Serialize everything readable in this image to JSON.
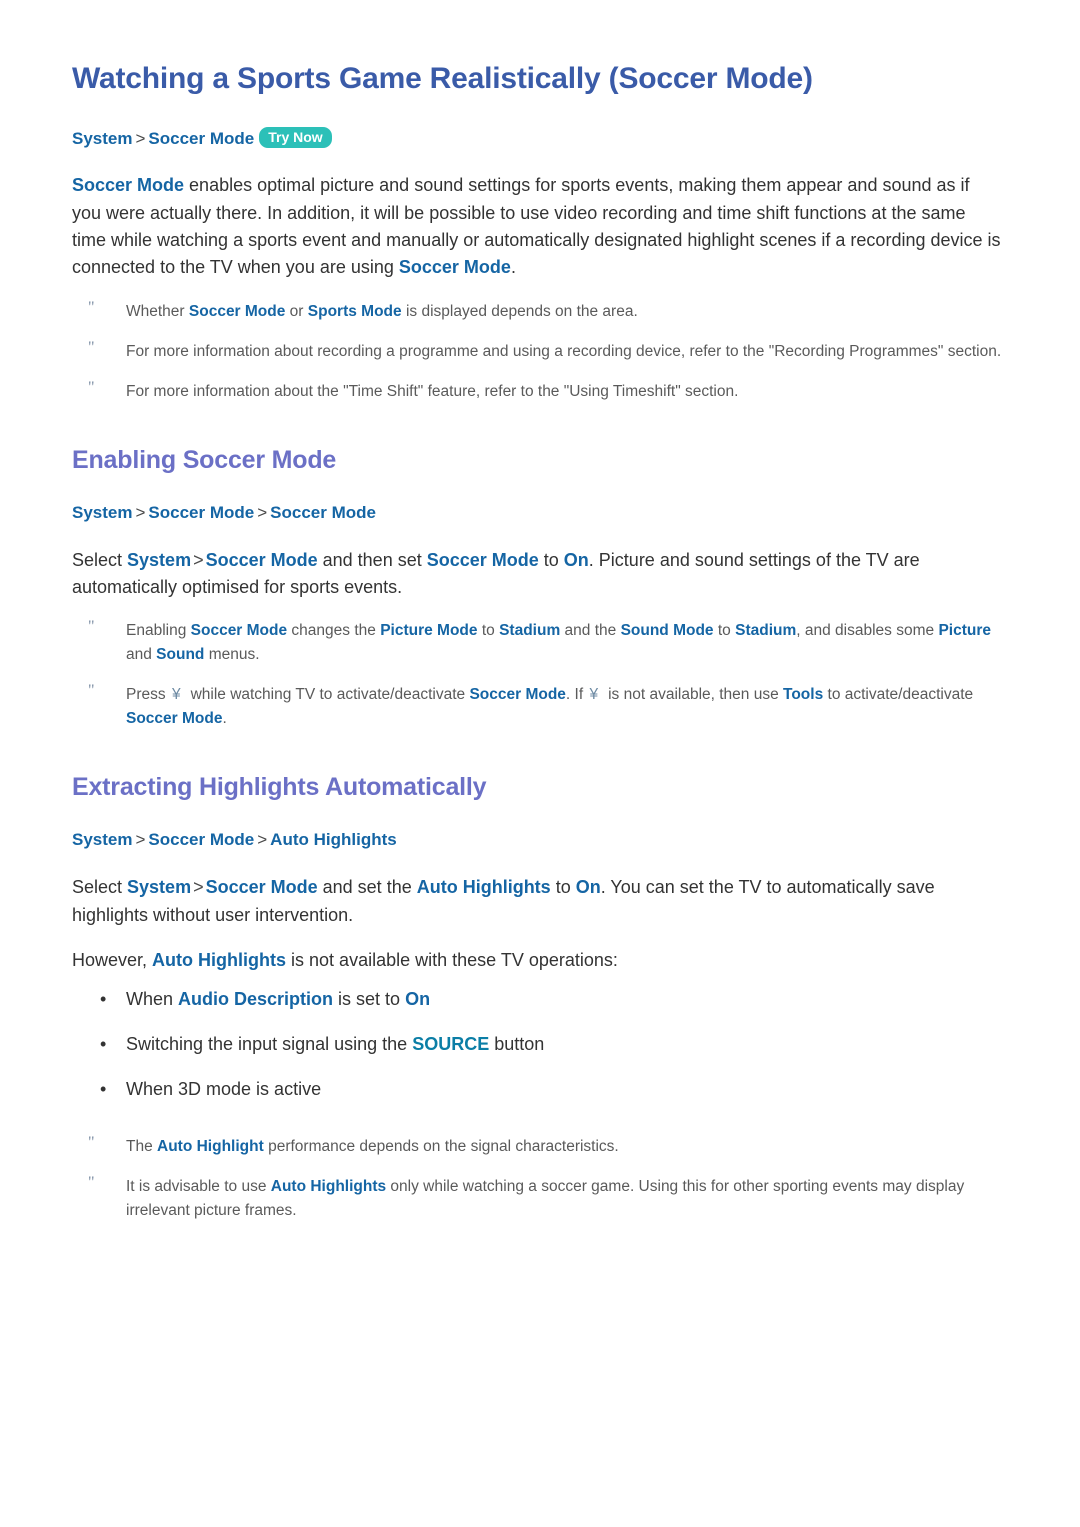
{
  "document": {
    "title": "Watching a Sports Game Realistically (Soccer Mode)"
  },
  "colors": {
    "title": "#3a5ba8",
    "section_heading": "#6b70c6",
    "keyword": "#1565a4",
    "source_keyword": "#0b7ea6",
    "try_now_badge": "#2cc0b8",
    "body_text": "#333333",
    "note_text": "#5a5a5a",
    "note_mark": "#7b8da3"
  },
  "intro": {
    "breadcrumb": {
      "items": [
        "System",
        "Soccer Mode"
      ],
      "separator": ">",
      "badge": "Try Now"
    },
    "paragraph": {
      "kw1": "Soccer Mode",
      "t1": " enables optimal picture and sound settings for sports events, making them appear and sound as if you were actually there. In addition, it will be possible to use video recording and time shift functions at the same time while watching a sports event and manually or automatically designated highlight scenes if a recording device is connected to the TV when you are using ",
      "kw2": "Soccer Mode",
      "t2": "."
    },
    "notes": [
      {
        "mark": "\"",
        "t1": "Whether ",
        "kw1": "Soccer Mode",
        "t2": " or ",
        "kw2": "Sports Mode",
        "t3": " is displayed depends on the area."
      },
      {
        "mark": "\"",
        "t1": "For more information about recording a programme and using a recording device, refer to the \"Recording Programmes\" section."
      },
      {
        "mark": "\"",
        "t1": "For more information about the \"Time Shift\" feature, refer to the \"Using Timeshift\" section."
      }
    ]
  },
  "enabling": {
    "heading": "Enabling Soccer Mode",
    "breadcrumb": {
      "items": [
        "System",
        "Soccer Mode",
        "Soccer Mode"
      ],
      "separator": ">"
    },
    "paragraph": {
      "t0": "Select ",
      "kw1": "System",
      "sep": ">",
      "kw2": "Soccer Mode",
      "t1": " and then set ",
      "kw3": "Soccer Mode",
      "t2": " to ",
      "kw4": "On",
      "t3": ". Picture and sound settings of the TV are automatically optimised for sports events."
    },
    "notes": [
      {
        "mark": "\"",
        "t1": "Enabling ",
        "kw1": "Soccer Mode",
        "t2": " changes the ",
        "kw2": "Picture Mode",
        "t3": " to ",
        "kw3": "Stadium",
        "t4": " and the ",
        "kw4": "Sound Mode",
        "t5": " to ",
        "kw5": "Stadium",
        "t6": ", and disables some ",
        "kw6": "Picture",
        "t7": " and ",
        "kw7": "Sound",
        "t8": " menus."
      },
      {
        "mark": "\"",
        "t1": "Press ",
        "glyph1": "¥",
        "t2": "while watching TV to activate/deactivate ",
        "kw1": "Soccer Mode",
        "t3": ". If ",
        "glyph2": "¥",
        "t4": "is not available, then use ",
        "kw2": "Tools",
        "t5": " to activate/deactivate ",
        "kw3": "Soccer Mode",
        "t6": "."
      }
    ]
  },
  "extracting": {
    "heading": "Extracting Highlights Automatically",
    "breadcrumb": {
      "items": [
        "System",
        "Soccer Mode",
        "Auto Highlights"
      ],
      "separator": ">"
    },
    "paragraph": {
      "t0": "Select ",
      "kw1": "System",
      "sep": ">",
      "kw2": "Soccer Mode",
      "t1": " and set the ",
      "kw3": "Auto Highlights",
      "t2": " to ",
      "kw4": "On",
      "t3": ". You can set the TV to automatically save highlights without user intervention."
    },
    "however": {
      "t1": "However, ",
      "kw1": "Auto Highlights",
      "t2": " is not available with these TV operations:"
    },
    "operations": [
      {
        "mark": "•",
        "t1": "When ",
        "kw1": "Audio Description",
        "t2": " is set to ",
        "kw2": "On",
        "t3": ""
      },
      {
        "mark": "•",
        "t1": "Switching the input signal using the ",
        "kwsrc": "SOURCE",
        "t2": " button"
      },
      {
        "mark": "•",
        "t1": "When 3D mode is active"
      }
    ],
    "notes": [
      {
        "mark": "\"",
        "t1": "The ",
        "kw1": "Auto Highlight",
        "t2": " performance depends on the signal characteristics."
      },
      {
        "mark": "\"",
        "t1": "It is advisable to use ",
        "kw1": "Auto Highlights",
        "t2": " only while watching a soccer game. Using this for other sporting events may display irrelevant picture frames."
      }
    ]
  }
}
